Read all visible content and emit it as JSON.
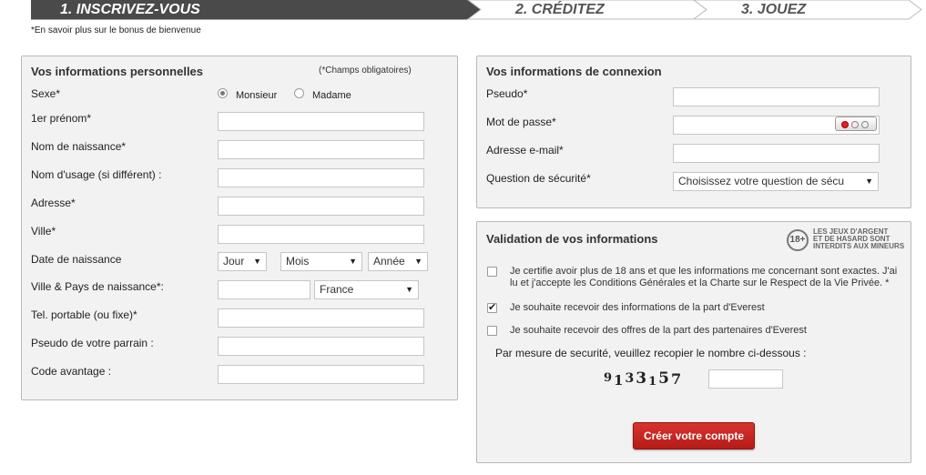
{
  "steps": {
    "step1": "1. INSCRIVEZ-VOUS",
    "step2": "2. CRÉDITEZ",
    "step3": "3. JOUEZ"
  },
  "bonus_link": "*En savoir plus sur le bonus de bienvenue",
  "personal": {
    "title": "Vos informations personnelles",
    "required_note": "(*Champs obligatoires)",
    "sexe_label": "Sexe*",
    "monsieur": "Monsieur",
    "madame": "Madame",
    "prenom_label": "1er prénom*",
    "nom_naissance_label": "Nom de naissance*",
    "nom_usage_label": "Nom d'usage (si différent) :",
    "adresse_label": "Adresse*",
    "ville_label": "Ville*",
    "date_label": "Date de naissance",
    "jour": "Jour",
    "mois": "Mois",
    "annee": "Année",
    "ville_pays_label": "Ville & Pays de naissance*:",
    "pays": "France",
    "tel_label": "Tel. portable (ou fixe)*",
    "parrain_label": "Pseudo de votre parrain :",
    "code_label": "Code avantage :"
  },
  "connexion": {
    "title": "Vos informations de connexion",
    "pseudo_label": "Pseudo*",
    "password_label": "Mot de passe*",
    "email_label": "Adresse e-mail*",
    "question_label": "Question de sécurité*",
    "question_value": "Choisissez votre question de sécu"
  },
  "validation": {
    "title": "Validation de vos informations",
    "badge": "18+",
    "badge_line1": "LES JEUX D'ARGENT",
    "badge_line2": "ET DE HASARD SONT",
    "badge_line3": "INTERDITS AUX MINEURS",
    "check1": "Je certifie avoir plus de 18 ans et que les informations me concernant sont exactes. J'ai lu et j'accepte les Conditions Générales et la Charte sur le Respect de la Vie Privée. *",
    "check2": "Je souhaite recevoir des informations de la part d'Everest",
    "check3": "Je souhaite recevoir des offres de la part des partenaires d'Everest",
    "security_text": "Par mesure de securité, veuillez recopier le nombre ci-dessous :",
    "captcha": [
      "9",
      "1",
      "3",
      "3",
      "1",
      "5",
      "7"
    ],
    "submit": "Créer votre compte"
  }
}
